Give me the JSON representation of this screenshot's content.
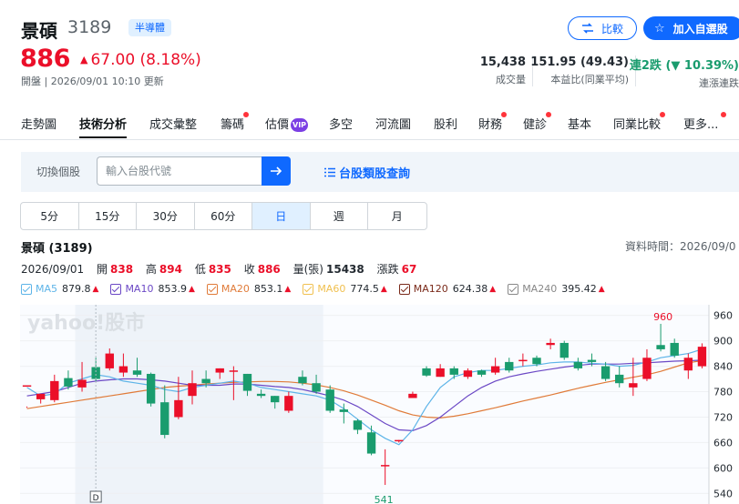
{
  "stock": {
    "name": "景碩",
    "code": "3189",
    "badge": "半導體",
    "price": "886",
    "change": "67.00 (8.18%)",
    "status": "開盤 | 2026/09/01 10:10 更新"
  },
  "actions": {
    "compare": "比較",
    "watchlist": "加入自選股"
  },
  "stats": {
    "volume_value": "15,438",
    "volume_label": "成交量",
    "pe_value": "151.95 (49.43)",
    "pe_label": "本益比(同業平均)",
    "streak_value": "連2跌 (▼ 10.39%)",
    "streak_label": "連漲連跌"
  },
  "tabs": [
    "走勢圖",
    "技術分析",
    "成交彙整",
    "籌碼",
    "估價",
    "多空",
    "河流圖",
    "股利",
    "財務",
    "健診",
    "基本",
    "同業比較",
    "更多..."
  ],
  "tab_vip": "VIP",
  "search": {
    "label": "切換個股",
    "placeholder": "輸入台股代號",
    "category_link": "台股類股查詢"
  },
  "periods": [
    "5分",
    "15分",
    "30分",
    "60分",
    "日",
    "週",
    "月"
  ],
  "chart_header": {
    "title": "景碩 (3189)",
    "data_time": "資料時間：2026/09/0",
    "date": "2026/09/01",
    "open_label": "開",
    "open": "838",
    "high_label": "高",
    "high": "894",
    "low_label": "低",
    "low": "835",
    "close_label": "收",
    "close": "886",
    "vol_label": "量(張)",
    "vol": "15438",
    "chg_label": "漲跌",
    "chg": "67"
  },
  "ma_legend": [
    {
      "name": "MA5",
      "value": "879.8",
      "color": "#5db4e8"
    },
    {
      "name": "MA10",
      "value": "853.9",
      "color": "#6b48c5"
    },
    {
      "name": "MA20",
      "value": "853.1",
      "color": "#e07b39"
    },
    {
      "name": "MA60",
      "value": "774.5",
      "color": "#f0c050"
    },
    {
      "name": "MA120",
      "value": "624.38",
      "color": "#7a2a1a"
    },
    {
      "name": "MA240",
      "value": "395.42",
      "color": "#888888"
    }
  ],
  "chart_data": {
    "type": "candlestick",
    "y_ticks": [
      960,
      900,
      840,
      780,
      720,
      660,
      600,
      540
    ],
    "ylim": [
      515,
      985
    ],
    "annotations": {
      "high_label": "960",
      "low_label": "541",
      "marker": "D"
    },
    "watermark": "yahoo!股市",
    "colors": {
      "up": "#eb0f29",
      "down": "#1a9c6e"
    },
    "candles": [
      [
        795,
        795,
        745,
        742
      ],
      [
        762,
        775,
        765,
        752
      ],
      [
        760,
        805,
        820,
        755
      ],
      [
        812,
        792,
        830,
        785
      ],
      [
        790,
        808,
        850,
        780
      ],
      [
        838,
        810,
        860,
        805
      ],
      [
        835,
        870,
        882,
        830
      ],
      [
        825,
        840,
        870,
        815
      ],
      [
        830,
        820,
        860,
        815
      ],
      [
        822,
        752,
        825,
        745
      ],
      [
        755,
        678,
        795,
        670
      ],
      [
        720,
        760,
        815,
        715
      ],
      [
        770,
        800,
        830,
        750
      ],
      [
        810,
        800,
        830,
        790
      ],
      [
        825,
        835,
        835,
        810
      ],
      [
        830,
        830,
        840,
        760
      ],
      [
        822,
        782,
        822,
        770
      ],
      [
        775,
        770,
        785,
        765
      ],
      [
        770,
        755,
        770,
        740
      ],
      [
        735,
        770,
        780,
        730
      ],
      [
        815,
        800,
        830,
        795
      ],
      [
        800,
        780,
        820,
        775
      ],
      [
        785,
        735,
        795,
        730
      ],
      [
        738,
        732,
        752,
        705
      ],
      [
        712,
        690,
        715,
        680
      ],
      [
        684,
        634,
        700,
        630
      ],
      [
        607,
        607,
        644,
        560
      ],
      [
        666,
        666,
        666,
        660
      ],
      [
        765,
        775,
        780,
        765
      ],
      [
        835,
        818,
        840,
        815
      ],
      [
        815,
        835,
        845,
        815
      ],
      [
        835,
        820,
        840,
        810
      ],
      [
        815,
        830,
        835,
        810
      ],
      [
        830,
        820,
        832,
        815
      ],
      [
        825,
        840,
        860,
        820
      ],
      [
        850,
        830,
        860,
        825
      ],
      [
        855,
        855,
        870,
        840
      ],
      [
        860,
        845,
        865,
        840
      ],
      [
        890,
        895,
        905,
        880
      ],
      [
        895,
        860,
        900,
        855
      ],
      [
        850,
        835,
        860,
        830
      ],
      [
        855,
        850,
        870,
        840
      ],
      [
        840,
        810,
        850,
        805
      ],
      [
        820,
        800,
        840,
        790
      ],
      [
        790,
        800,
        860,
        770
      ],
      [
        810,
        860,
        880,
        805
      ],
      [
        890,
        880,
        940,
        875
      ],
      [
        895,
        865,
        905,
        860
      ],
      [
        830,
        860,
        870,
        810
      ],
      [
        840,
        886,
        894,
        835
      ]
    ],
    "ma5": [
      790,
      770,
      775,
      800,
      810,
      820,
      815,
      805,
      800,
      795,
      785,
      780,
      790,
      795,
      800,
      805,
      800,
      790,
      785,
      780,
      775,
      770,
      760,
      740,
      715,
      690,
      670,
      655,
      690,
      745,
      790,
      815,
      825,
      830,
      830,
      835,
      840,
      843,
      848,
      850,
      850,
      847,
      845,
      840,
      842,
      850,
      860,
      865,
      870,
      880
    ],
    "ma10": [
      770,
      775,
      780,
      790,
      800,
      805,
      808,
      810,
      810,
      808,
      805,
      800,
      795,
      795,
      795,
      798,
      798,
      795,
      792,
      790,
      785,
      778,
      770,
      760,
      745,
      725,
      705,
      690,
      688,
      700,
      720,
      745,
      770,
      790,
      805,
      815,
      822,
      828,
      833,
      838,
      842,
      845,
      845,
      845,
      847,
      848,
      850,
      852,
      853,
      854
    ],
    "ma20": [
      740,
      745,
      750,
      755,
      760,
      765,
      770,
      775,
      780,
      785,
      790,
      793,
      795,
      798,
      800,
      802,
      803,
      804,
      804,
      803,
      800,
      796,
      790,
      782,
      772,
      760,
      748,
      735,
      725,
      720,
      718,
      722,
      728,
      735,
      742,
      750,
      758,
      765,
      772,
      780,
      788,
      795,
      802,
      808,
      814,
      820,
      828,
      838,
      848,
      853
    ]
  }
}
